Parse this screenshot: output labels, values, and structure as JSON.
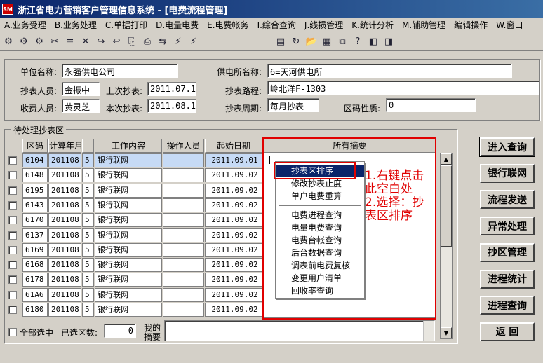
{
  "window": {
    "icon_text": "SM",
    "title": "浙江省电力营销客户管理信息系统 - [电费流程管理]"
  },
  "menu": [
    {
      "key": "A",
      "label": "业务受理"
    },
    {
      "key": "B",
      "label": "业务处理"
    },
    {
      "key": "C",
      "label": "单据打印"
    },
    {
      "key": "D",
      "label": "电量电费"
    },
    {
      "key": "E",
      "label": "电费帐务"
    },
    {
      "key": "I",
      "label": "综合查询"
    },
    {
      "key": "J",
      "label": "线损管理"
    },
    {
      "key": "K",
      "label": "统计分析"
    },
    {
      "key": "M",
      "label": "辅助管理"
    },
    {
      "key": "",
      "label": "编辑操作"
    },
    {
      "key": "W",
      "label": "窗口"
    }
  ],
  "toolbar_icons": [
    "⚙",
    "⚙",
    "⚙",
    "✂",
    "≡",
    "✕",
    "↪",
    "↩",
    "⎘",
    "⎙",
    "⇆",
    "⚡",
    "⚡",
    "▤",
    "↻",
    "📂",
    "▦",
    "⧉",
    "?",
    "◧",
    "◨"
  ],
  "info": {
    "unit_label": "单位名称:",
    "unit_value": "永强供电公司",
    "station_label": "供电所名称:",
    "station_value": "6=天河供电所",
    "reader_label": "抄表人员:",
    "reader_value": "金振中",
    "last_read_label": "上次抄表:",
    "last_read_value": "2011.07.10",
    "route_label": "抄表路程:",
    "route_value": "岭北洋F-1303",
    "collector_label": "收费人员:",
    "collector_value": "黄灵芝",
    "this_read_label": "本次抄表:",
    "this_read_value": "2011.08.10",
    "cycle_label": "抄表周期:",
    "cycle_value": "每月抄表",
    "zone_nature_label": "区码性质:",
    "zone_nature_value": "0"
  },
  "grid": {
    "group_title": "待处理抄表区",
    "headers": [
      "区码",
      "计算年月",
      "",
      "工作内容",
      "操作人员",
      "起始日期",
      "所有摘要"
    ],
    "rows": [
      {
        "code": "6104",
        "ym": "201108",
        "n": "5",
        "work": "银行联网",
        "op": "",
        "date": "2011.09.01"
      },
      {
        "code": "6148",
        "ym": "201108",
        "n": "5",
        "work": "银行联网",
        "op": "",
        "date": "2011.09.02"
      },
      {
        "code": "6195",
        "ym": "201108",
        "n": "5",
        "work": "银行联网",
        "op": "",
        "date": "2011.09.02"
      },
      {
        "code": "6143",
        "ym": "201108",
        "n": "5",
        "work": "银行联网",
        "op": "",
        "date": "2011.09.02"
      },
      {
        "code": "6170",
        "ym": "201108",
        "n": "5",
        "work": "银行联网",
        "op": "",
        "date": "2011.09.02"
      },
      {
        "code": "6137",
        "ym": "201108",
        "n": "5",
        "work": "银行联网",
        "op": "",
        "date": "2011.09.02"
      },
      {
        "code": "6169",
        "ym": "201108",
        "n": "5",
        "work": "银行联网",
        "op": "",
        "date": "2011.09.02"
      },
      {
        "code": "6168",
        "ym": "201108",
        "n": "5",
        "work": "银行联网",
        "op": "",
        "date": "2011.09.02"
      },
      {
        "code": "6178",
        "ym": "201108",
        "n": "5",
        "work": "银行联网",
        "op": "",
        "date": "2011.09.02"
      },
      {
        "code": "61A6",
        "ym": "201108",
        "n": "5",
        "work": "银行联网",
        "op": "",
        "date": "2011.09.02"
      },
      {
        "code": "6180",
        "ym": "201108",
        "n": "5",
        "work": "银行联网",
        "op": "",
        "date": "2011.09.02"
      }
    ]
  },
  "context_menu": {
    "items_top": [
      "抄表区排序",
      "修改抄表止度",
      "单户电费重算"
    ],
    "items_bottom": [
      "电费进程查询",
      "电量电费查询",
      "电费台帐查询",
      "后台数据查询",
      "调表前电费复核",
      "变更用户清单",
      "回收率查询"
    ]
  },
  "annotation": {
    "line1": "1.右键点击",
    "line2": "此空白处",
    "line3": "2.选择：抄",
    "line4": "表区排序",
    "color": "#e00000"
  },
  "footer": {
    "select_all_label": "全部选中",
    "selected_count_label": "已选区数:",
    "selected_count_value": "0",
    "my_summary_label_1": "我的",
    "my_summary_label_2": "摘要"
  },
  "buttons": [
    "进入查询",
    "银行联网",
    "流程发送",
    "异常处理",
    "抄区管理",
    "进程统计",
    "进程查询",
    "返 回"
  ]
}
